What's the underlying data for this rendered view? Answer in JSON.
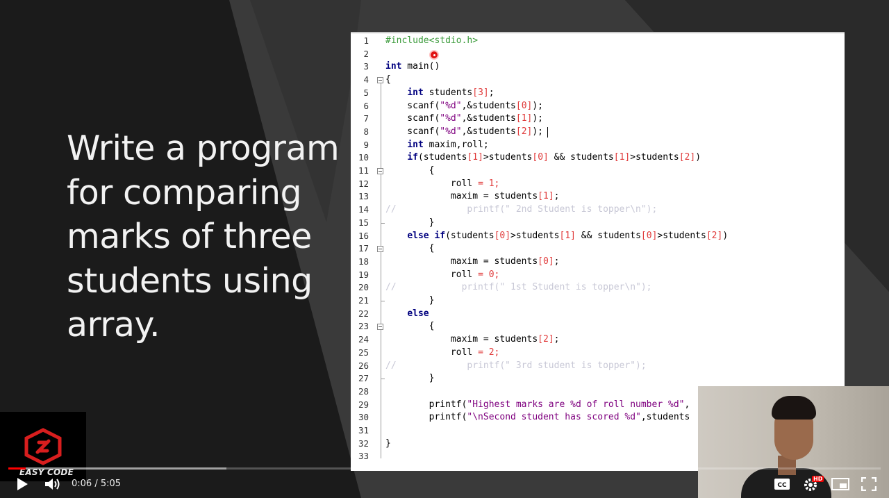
{
  "slide": {
    "lines": [
      "Write a program",
      "for comparing",
      "marks of three",
      "students using",
      "array."
    ]
  },
  "editor": {
    "line_numbers": [
      "1",
      "2",
      "3",
      "4",
      "5",
      "6",
      "7",
      "8",
      "9",
      "10",
      "11",
      "12",
      "13",
      "14",
      "15",
      "16",
      "17",
      "18",
      "19",
      "20",
      "21",
      "22",
      "23",
      "24",
      "25",
      "26",
      "27",
      "28",
      "29",
      "30",
      "31",
      "32",
      "33"
    ],
    "lines": [
      "#include<stdio.h>",
      "",
      "int main()",
      "{",
      "    int students[3];",
      "    scanf(\"%d\",&students[0]);",
      "    scanf(\"%d\",&students[1]);",
      "    scanf(\"%d\",&students[2]);",
      "    int maxim,roll;",
      "    if(students[1]>students[0] && students[1]>students[2])",
      "        {",
      "            roll = 1;",
      "            maxim = students[1];",
      "//             printf(\" 2nd Student is topper\\n\");",
      "        }",
      "    else if(students[0]>students[1] && students[0]>students[2])",
      "        {",
      "            maxim = students[0];",
      "            roll = 0;",
      "//            printf(\" 1st Student is topper\\n\");",
      "        }",
      "    else",
      "        {",
      "            maxim = students[2];",
      "            roll = 2;",
      "//             printf(\" 3rd student is topper\");",
      "        }",
      "",
      "        printf(\"Highest marks are %d of roll number %d\",",
      "        printf(\"\\nSecond student has scored %d\",students",
      "",
      "}",
      ""
    ]
  },
  "branding": {
    "logo_text": "EASY CODE"
  },
  "player": {
    "current_time": "0:06",
    "separator": " / ",
    "duration": "5:05",
    "played_fraction": 0.02,
    "buffered_fraction": 0.25,
    "hd_badge": "HD",
    "icons": [
      "play-icon",
      "volume-icon",
      "captions-icon",
      "settings-icon",
      "miniplayer-icon",
      "fullscreen-icon"
    ]
  },
  "colors": {
    "progress": "#ff0000",
    "logo_red": "#d81e1e"
  }
}
